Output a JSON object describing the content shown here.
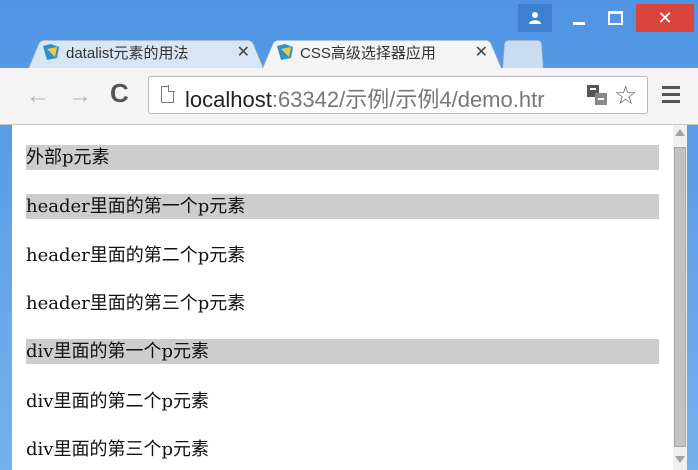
{
  "window": {
    "controls": {
      "user_icon": "user-icon",
      "minimize_icon": "minimize-icon",
      "maximize_icon": "maximize-icon",
      "close_label": "✕"
    }
  },
  "tabs": [
    {
      "label": "datalist元素的用法",
      "close": "✕",
      "active": false
    },
    {
      "label": "CSS高级选择器应用",
      "close": "✕",
      "active": true
    }
  ],
  "toolbar": {
    "back": "←",
    "forward": "→",
    "reload": "C",
    "url_host": "localhost",
    "url_rest": ":63342/示例/示例4/demo.htr",
    "star": "☆"
  },
  "page": {
    "paragraphs": [
      {
        "text": "外部p元素",
        "highlighted": true
      },
      {
        "text": "header里面的第一个p元素",
        "highlighted": true
      },
      {
        "text": "header里面的第二个p元素",
        "highlighted": false
      },
      {
        "text": "header里面的第三个p元素",
        "highlighted": false
      },
      {
        "text": "div里面的第一个p元素",
        "highlighted": true
      },
      {
        "text": "div里面的第二个p元素",
        "highlighted": false
      },
      {
        "text": "div里面的第三个p元素",
        "highlighted": false
      }
    ]
  },
  "colors": {
    "highlight": "#cdcdcd",
    "titlebar": "#5a9be6",
    "close": "#d9453c"
  }
}
